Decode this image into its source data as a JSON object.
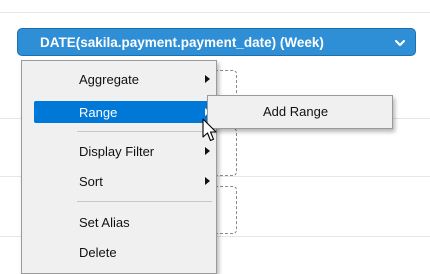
{
  "field_pill": {
    "label": "DATE(sakila.payment.payment_date) (Week)",
    "icon": "chevron-down-icon",
    "color": "#2e8fd6"
  },
  "context_menu": {
    "items": [
      {
        "label": "Aggregate",
        "submenu": true
      },
      {
        "label": "Range",
        "submenu": true,
        "highlighted": true
      },
      {
        "label": "Display Filter",
        "submenu": true
      },
      {
        "label": "Sort",
        "submenu": true
      },
      {
        "label": "Set Alias",
        "submenu": false
      },
      {
        "label": "Delete",
        "submenu": false
      }
    ],
    "highlight_color": "#0078d7"
  },
  "range_submenu": {
    "items": [
      {
        "label": "Add Range"
      }
    ]
  },
  "cursor": {
    "icon": "mouse-pointer-icon"
  }
}
